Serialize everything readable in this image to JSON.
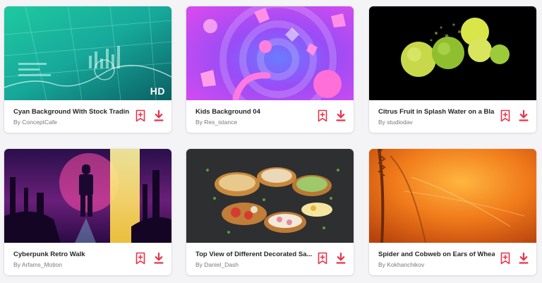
{
  "colors": {
    "accent": "#e8334a",
    "title": "#262626",
    "author": "#7a7a80",
    "background": "#f4f4f6"
  },
  "cards": [
    {
      "title": "Cyan Background With Stock Tradin...",
      "author_prefix": "By",
      "author": "ConceptCafe",
      "badge": "HD",
      "add_icon": "add-to-collection-icon",
      "download_icon": "download-icon"
    },
    {
      "title": "Kids Background 04",
      "author_prefix": "By",
      "author": "Res_istance",
      "add_icon": "add-to-collection-icon",
      "download_icon": "download-icon"
    },
    {
      "title": "Citrus Fruit in Splash Water on a Bla...",
      "author_prefix": "By",
      "author": "studiodav",
      "add_icon": "add-to-collection-icon",
      "download_icon": "download-icon"
    },
    {
      "title": "Cyberpunk Retro Walk",
      "author_prefix": "By",
      "author": "Arfams_Motion",
      "add_icon": "add-to-collection-icon",
      "download_icon": "download-icon"
    },
    {
      "title": "Top View of Different Decorated Sa...",
      "author_prefix": "By",
      "author": "Daniel_Dash",
      "add_icon": "add-to-collection-icon",
      "download_icon": "download-icon"
    },
    {
      "title": "Spider and Cobweb on Ears of Whea...",
      "author_prefix": "By",
      "author": "Kokhanchikov",
      "add_icon": "add-to-collection-icon",
      "download_icon": "download-icon"
    }
  ]
}
